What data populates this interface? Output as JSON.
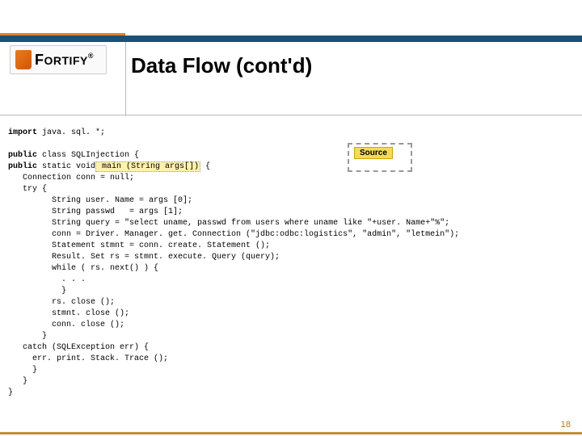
{
  "logo": {
    "text": "ORTIFY",
    "first": "F",
    "reg": "®"
  },
  "title": "Data Flow (cont'd)",
  "callout": {
    "label": "Source"
  },
  "page_number": "18",
  "code": {
    "l01a": "import",
    "l01b": " java. sql. *;",
    "l03a": "public",
    "l03b": " class SQLInjection {",
    "l04a": "public",
    "l04b": " static void",
    "l04h": " main (String args[])",
    "l04c": " {",
    "l05": "   Connection conn = null;",
    "l06": "   try {",
    "l07": "         String user. Name = args [0];",
    "l08": "         String passwd   = args [1];",
    "l09": "         String query = \"select uname, passwd from users where uname like \"+user. Name+\"%\";",
    "l10": "         conn = Driver. Manager. get. Connection (\"jdbc:odbc:logistics\", \"admin\", \"letmein\");",
    "l11": "         Statement stmnt = conn. create. Statement ();",
    "l12": "         Result. Set rs = stmnt. execute. Query (query);",
    "l13": "         while ( rs. next() ) {",
    "l14": "           . . .",
    "l15": "           }",
    "l16": "         rs. close ();",
    "l17": "         stmnt. close ();",
    "l18": "         conn. close ();",
    "l19": "       }",
    "l20": "   catch (SQLException err) {",
    "l21": "     err. print. Stack. Trace ();",
    "l22": "     }",
    "l23": "   }",
    "l24": "}"
  }
}
